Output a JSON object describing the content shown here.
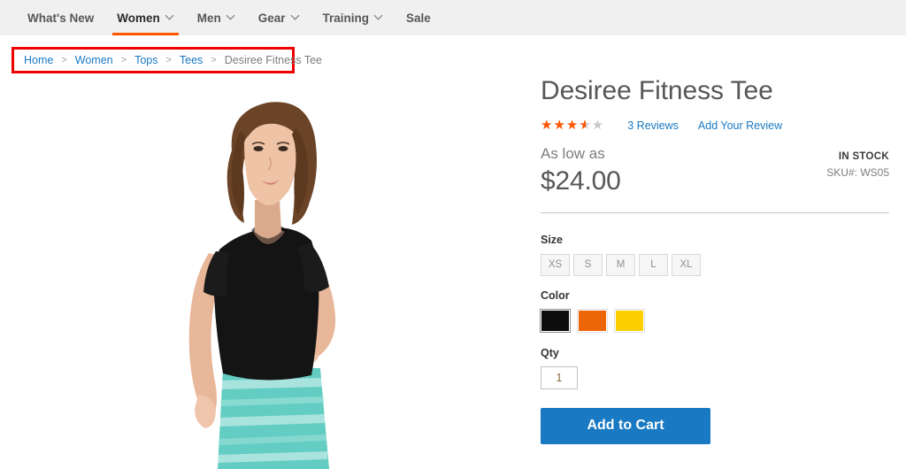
{
  "nav": {
    "items": [
      {
        "label": "What's New",
        "has_caret": false,
        "active": false
      },
      {
        "label": "Women",
        "has_caret": true,
        "active": true
      },
      {
        "label": "Men",
        "has_caret": true,
        "active": false
      },
      {
        "label": "Gear",
        "has_caret": true,
        "active": false
      },
      {
        "label": "Training",
        "has_caret": true,
        "active": false
      },
      {
        "label": "Sale",
        "has_caret": false,
        "active": false
      }
    ],
    "active_accent": "#ff5501",
    "background": "#f0f0f0"
  },
  "breadcrumb": {
    "separator": ">",
    "highlight_color": "#ee0000",
    "items": [
      {
        "label": "Home",
        "current": false
      },
      {
        "label": "Women",
        "current": false
      },
      {
        "label": "Tops",
        "current": false
      },
      {
        "label": "Tees",
        "current": false
      },
      {
        "label": "Desiree Fitness Tee",
        "current": true
      }
    ]
  },
  "gallery": {
    "alt": "Model wearing black fitness tee with teal striped leggings",
    "shirt_color": "#111111",
    "leggings_color": "#63cdc3",
    "background": "#ffffff"
  },
  "product": {
    "title": "Desiree Fitness Tee",
    "rating": {
      "value": 3.5,
      "max": 5,
      "percent": 70,
      "filled_color": "#ff5501",
      "empty_color": "#c7c7c7",
      "glyph": "★★★★★"
    },
    "reviews_link": "3  Reviews",
    "add_review_link": "Add Your Review",
    "price_label": "As low as",
    "price": "$24.00",
    "stock_status": "IN STOCK",
    "sku": "SKU#:  WS05",
    "options": {
      "size_label": "Size",
      "sizes": [
        "XS",
        "S",
        "M",
        "L",
        "XL"
      ],
      "color_label": "Color",
      "colors": [
        {
          "name": "black",
          "hex": "#0d0d0d",
          "selected": true
        },
        {
          "name": "orange",
          "hex": "#ec6608",
          "selected": false
        },
        {
          "name": "yellow",
          "hex": "#fecf00",
          "selected": false
        }
      ]
    },
    "qty_label": "Qty",
    "qty_value": "1",
    "add_to_cart_label": "Add to Cart",
    "accent_button_color": "#1979c3"
  }
}
